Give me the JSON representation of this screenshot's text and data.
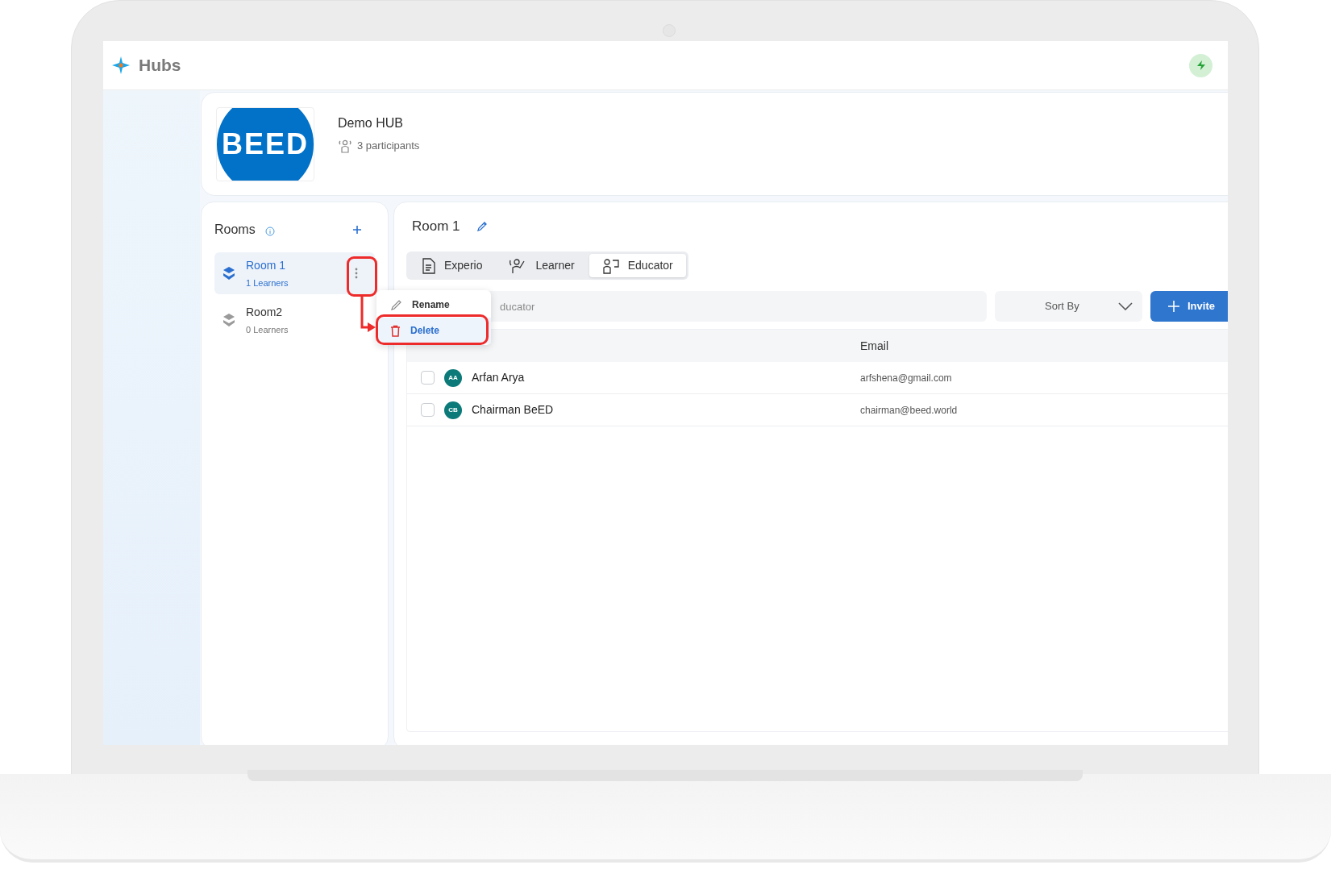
{
  "app": {
    "title": "Hubs"
  },
  "hub": {
    "name": "Demo HUB",
    "logo_text": "BEED",
    "participants": "3 participants"
  },
  "rooms_panel": {
    "title": "Rooms",
    "rooms": [
      {
        "name": "Room 1",
        "learners": "1 Learners",
        "selected": true
      },
      {
        "name": "Room2",
        "learners": "0 Learners",
        "selected": false
      }
    ]
  },
  "context_menu": {
    "items": [
      {
        "kind": "rename",
        "label": "Rename",
        "selected": false
      },
      {
        "kind": "delete",
        "label": "Delete",
        "selected": true
      }
    ]
  },
  "room": {
    "title": "Room 1",
    "tabs": [
      {
        "kind": "document",
        "label": "Experio",
        "selected": false
      },
      {
        "kind": "learner",
        "label": "Learner",
        "selected": false
      },
      {
        "kind": "educator",
        "label": "Educator",
        "selected": true
      }
    ],
    "search": {
      "placeholder": "ducator"
    },
    "sort": {
      "label": "Sort By"
    },
    "invite_button": "Invite",
    "table": {
      "columns": [
        "Email"
      ],
      "rows": [
        {
          "initials": "AA",
          "name": "Arfan Arya",
          "email": "arfshena@gmail.com",
          "checked": false
        },
        {
          "initials": "CB",
          "name": "Chairman BeED",
          "email": "chairman@beed.world",
          "checked": false
        }
      ]
    }
  }
}
